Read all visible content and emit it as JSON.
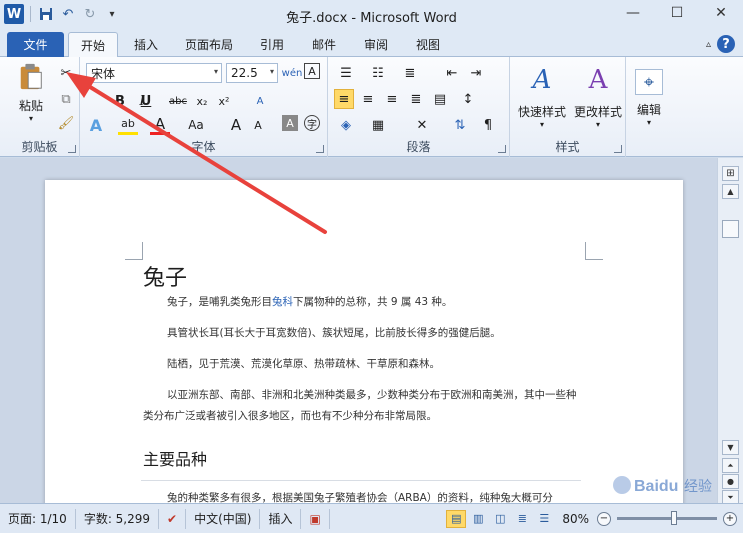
{
  "window": {
    "title": "兔子.docx - Microsoft Word",
    "minimize": "—",
    "maximize": "☐",
    "close": "✕"
  },
  "qat": {
    "logo": "W",
    "save_icon": "save-icon",
    "undo_icon": "undo-icon",
    "redo_icon": "redo-icon",
    "customize": "▾"
  },
  "tabs": [
    {
      "label": "文件"
    },
    {
      "label": "开始"
    },
    {
      "label": "插入"
    },
    {
      "label": "页面布局"
    },
    {
      "label": "引用"
    },
    {
      "label": "邮件"
    },
    {
      "label": "审阅"
    },
    {
      "label": "视图"
    }
  ],
  "help": "?",
  "ribbon": {
    "clipboard": {
      "paste": "粘贴",
      "label": "剪贴板"
    },
    "font": {
      "name": "宋体",
      "size": "22.5",
      "label": "字体",
      "bold": "B",
      "italic": "I",
      "underline": "U",
      "strike": "abc",
      "sub": "x₂",
      "sup": "x²",
      "effects": "A",
      "highlight": "ab",
      "color": "A",
      "case": "Aa",
      "grow": "A",
      "shrink": "A",
      "clear": "A",
      "phonetic": "wén",
      "border": "A",
      "charshade": "A",
      "enclose": "字"
    },
    "paragraph": {
      "label": "段落"
    },
    "styles": {
      "quick": "快速样式",
      "change": "更改样式",
      "label": "样式"
    },
    "edit": {
      "label": "编辑"
    }
  },
  "document": {
    "heading": "兔子",
    "paragraphs": [
      {
        "before": "兔子，是哺乳类兔形目",
        "link": "兔科",
        "after": "下属物种的总称，共 9 属 43 种。"
      },
      {
        "before": "具管状长耳(耳长大于耳宽数倍)、簇状短尾，比前肢长得多的强健后腿。",
        "link": "",
        "after": ""
      },
      {
        "before": "陆栖，见于荒漠、荒漠化草原、热带疏林、干草原和森林。",
        "link": "",
        "after": ""
      },
      {
        "before": "以亚洲东部、南部、非洲和北美洲种类最多，少数种类分布于欧洲和南美洲，其中一些种类分布广泛或者被引入很多地区，而也有不少种分布非常局限。",
        "link": "",
        "after": ""
      }
    ],
    "subheading": "主要品种",
    "cut_line": "兔的种类繁多有很多，根据美国兔子繁殖者协会（ARBA）的资料，纯种兔大概可分"
  },
  "status": {
    "page": "页面: 1/10",
    "words": "字数: 5,299",
    "language": "中文(中国)",
    "mode": "插入",
    "zoom": "80%"
  },
  "colors": {
    "accent": "#2a62b5",
    "arrow": "#e8423c"
  },
  "watermark": "Baidu 经验"
}
